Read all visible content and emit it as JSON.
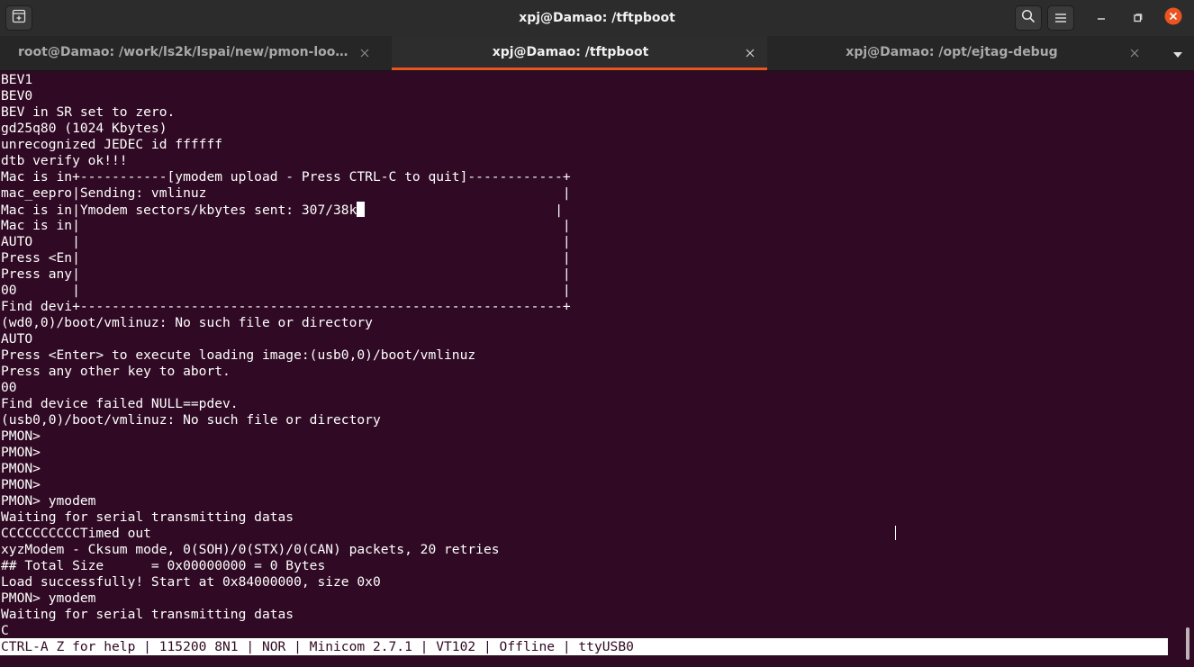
{
  "window": {
    "title": "xpj@Damao: /tftpboot"
  },
  "header_icons": {
    "new_tab": "new-tab-icon",
    "search": "search-icon",
    "menu": "hamburger-menu-icon",
    "minimize": "minimize-icon",
    "maximize": "maximize-icon",
    "close": "close-icon"
  },
  "colors": {
    "terminal_bg": "#300a24",
    "terminal_fg": "#ffffff",
    "tab_accent": "#e95420",
    "close_button": "#e95420"
  },
  "tabs": [
    {
      "label": "root@Damao: /work/ls2k/lspai/new/pmon-loong...",
      "active": false
    },
    {
      "label": "xpj@Damao: /tftpboot",
      "active": true
    },
    {
      "label": "xpj@Damao: /opt/ejtag-debug",
      "active": false
    }
  ],
  "terminal": {
    "lines": [
      "BEV1",
      "BEV0",
      "BEV in SR set to zero.",
      "gd25q80 (1024 Kbytes)",
      "unrecognized JEDEC id ffffff",
      "dtb verify ok!!!",
      "Mac is in+-----------[ymodem upload - Press CTRL-C to quit]------------+",
      "mac_eepro|Sending: vmlinuz                                             |",
      "Mac is in|Ymodem sectors/kbytes sent: 307/38k",
      "Mac is in|                                                             |",
      "AUTO     |                                                             |",
      "Press <En|                                                             |",
      "Press any|                                                             |",
      "00       |                                                             |",
      "Find devi+-------------------------------------------------------------+",
      "(wd0,0)/boot/vmlinuz: No such file or directory",
      "AUTO",
      "Press <Enter> to execute loading image:(usb0,0)/boot/vmlinuz",
      "Press any other key to abort.",
      "00",
      "Find device failed NULL==pdev.",
      "(usb0,0)/boot/vmlinuz: No such file or directory",
      "PMON>",
      "PMON>",
      "PMON>",
      "PMON>",
      "PMON> ymodem",
      "Waiting for serial transmitting datas",
      "CCCCCCCCCCTimed out",
      "xyzModem - Cksum mode, 0(SOH)/0(STX)/0(CAN) packets, 20 retries",
      "## Total Size      = 0x00000000 = 0 Bytes",
      "Load successfully! Start at 0x84000000, size 0x0",
      "PMON> ymodem",
      "Waiting for serial transmitting datas",
      "C"
    ],
    "cursor_line_suffix": "                        |",
    "status_line": "CTRL-A Z for help | 115200 8N1 | NOR | Minicom 2.7.1 | VT102 | Offline | ttyUSB0"
  }
}
